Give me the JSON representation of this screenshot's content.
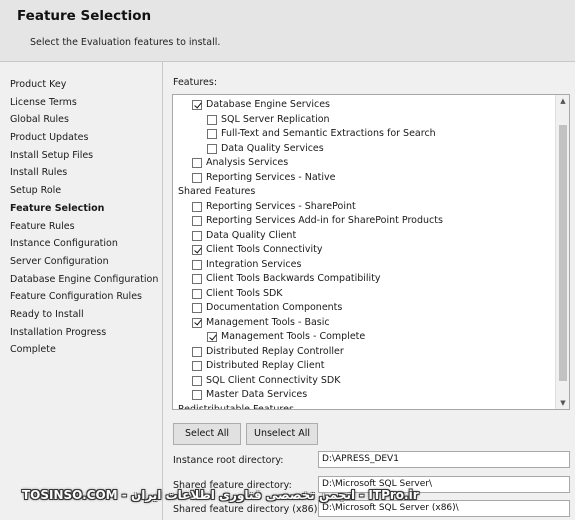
{
  "header": {
    "title": "Feature Selection",
    "subtitle": "Select the Evaluation features to install."
  },
  "steps": [
    {
      "label": "Product Key",
      "current": false
    },
    {
      "label": "License Terms",
      "current": false
    },
    {
      "label": "Global Rules",
      "current": false
    },
    {
      "label": "Product Updates",
      "current": false
    },
    {
      "label": "Install Setup Files",
      "current": false
    },
    {
      "label": "Install Rules",
      "current": false
    },
    {
      "label": "Setup Role",
      "current": false
    },
    {
      "label": "Feature Selection",
      "current": true
    },
    {
      "label": "Feature Rules",
      "current": false
    },
    {
      "label": "Instance Configuration",
      "current": false
    },
    {
      "label": "Server Configuration",
      "current": false
    },
    {
      "label": "Database Engine Configuration",
      "current": false
    },
    {
      "label": "Feature Configuration Rules",
      "current": false
    },
    {
      "label": "Ready to Install",
      "current": false
    },
    {
      "label": "Installation Progress",
      "current": false
    },
    {
      "label": "Complete",
      "current": false
    }
  ],
  "features": {
    "label": "Features:",
    "items": [
      {
        "label": "Database Engine Services",
        "checked": true,
        "level": 1,
        "heading": false
      },
      {
        "label": "SQL Server Replication",
        "checked": false,
        "level": 2,
        "heading": false
      },
      {
        "label": "Full-Text and Semantic Extractions for Search",
        "checked": false,
        "level": 2,
        "heading": false
      },
      {
        "label": "Data Quality Services",
        "checked": false,
        "level": 2,
        "heading": false
      },
      {
        "label": "Analysis Services",
        "checked": false,
        "level": 1,
        "heading": false
      },
      {
        "label": "Reporting Services - Native",
        "checked": false,
        "level": 1,
        "heading": false
      },
      {
        "label": "Shared Features",
        "checked": false,
        "level": 0,
        "heading": true
      },
      {
        "label": "Reporting Services - SharePoint",
        "checked": false,
        "level": 1,
        "heading": false
      },
      {
        "label": "Reporting Services Add-in for SharePoint Products",
        "checked": false,
        "level": 1,
        "heading": false
      },
      {
        "label": "Data Quality Client",
        "checked": false,
        "level": 1,
        "heading": false
      },
      {
        "label": "Client Tools Connectivity",
        "checked": true,
        "level": 1,
        "heading": false
      },
      {
        "label": "Integration Services",
        "checked": false,
        "level": 1,
        "heading": false
      },
      {
        "label": "Client Tools Backwards Compatibility",
        "checked": false,
        "level": 1,
        "heading": false
      },
      {
        "label": "Client Tools SDK",
        "checked": false,
        "level": 1,
        "heading": false
      },
      {
        "label": "Documentation Components",
        "checked": false,
        "level": 1,
        "heading": false
      },
      {
        "label": "Management Tools - Basic",
        "checked": true,
        "level": 1,
        "heading": false
      },
      {
        "label": "Management Tools - Complete",
        "checked": true,
        "level": 2,
        "heading": false
      },
      {
        "label": "Distributed Replay Controller",
        "checked": false,
        "level": 1,
        "heading": false
      },
      {
        "label": "Distributed Replay Client",
        "checked": false,
        "level": 1,
        "heading": false
      },
      {
        "label": "SQL Client Connectivity SDK",
        "checked": false,
        "level": 1,
        "heading": false
      },
      {
        "label": "Master Data Services",
        "checked": false,
        "level": 1,
        "heading": false
      },
      {
        "label": "Redistributable Features",
        "checked": false,
        "level": 0,
        "heading": true
      }
    ]
  },
  "buttons": {
    "select_all": "Select All",
    "unselect_all": "Unselect All"
  },
  "directories": {
    "instance_root_label": "Instance root directory:",
    "instance_root_value": "D:\\APRESS_DEV1",
    "shared_label": "Shared feature directory:",
    "shared_value": "D:\\Microsoft SQL Server\\",
    "shared_x86_label": "Shared feature directory (x86):",
    "shared_x86_value": "D:\\Microsoft SQL Server (x86)\\"
  },
  "watermark": "TOSINSO.COM - انجمن تخصصی فناوری اطلاعات ایران - ITPro.ir"
}
